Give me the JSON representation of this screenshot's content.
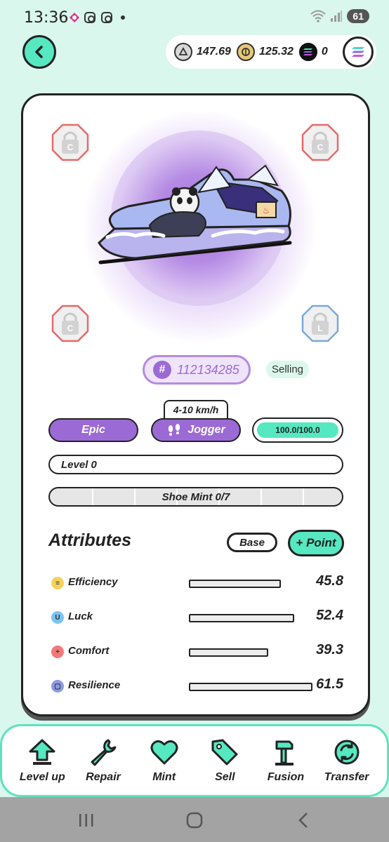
{
  "status_bar": {
    "time": "13:36",
    "battery": "61"
  },
  "wallet": {
    "gst": "147.69",
    "gmt": "125.32",
    "sol": "0"
  },
  "sneaker": {
    "id_symbol": "#",
    "id": "112134285",
    "status": "Selling",
    "speed_range": "4-10 km/h",
    "rarity": "Epic",
    "type": "Jogger",
    "durability": "100.0/100.0",
    "level": "Level 0",
    "shoe_mint": "Shoe Mint 0/7",
    "shoe_mint_fraction": 0.0,
    "gem_slots": [
      {
        "letter": "C",
        "state": "locked",
        "color": "#e46a6a"
      },
      {
        "letter": "C",
        "state": "locked",
        "color": "#e46a6a"
      },
      {
        "letter": "C",
        "state": "locked",
        "color": "#e46a6a"
      },
      {
        "letter": "L",
        "state": "locked",
        "color": "#7aa9d8"
      }
    ]
  },
  "attributes": {
    "title": "Attributes",
    "base_button": "Base",
    "point_button": "+ Point",
    "items": [
      {
        "label": "Efficiency",
        "value": "45.8",
        "fraction": 0.745,
        "icon_color": "#f5d35a"
      },
      {
        "label": "Luck",
        "value": "52.4",
        "fraction": 0.85,
        "icon_color": "#7bc4f0"
      },
      {
        "label": "Comfort",
        "value": "39.3",
        "fraction": 0.64,
        "icon_color": "#f07a7a"
      },
      {
        "label": "Resilience",
        "value": "61.5",
        "fraction": 1.0,
        "icon_color": "#8a9be0"
      }
    ]
  },
  "actions": [
    {
      "label": "Level up",
      "icon": "level-up-icon"
    },
    {
      "label": "Repair",
      "icon": "wrench-icon"
    },
    {
      "label": "Mint",
      "icon": "heart-icon"
    },
    {
      "label": "Sell",
      "icon": "tag-icon"
    },
    {
      "label": "Fusion",
      "icon": "hammer-icon"
    },
    {
      "label": "Transfer",
      "icon": "transfer-icon"
    }
  ],
  "colors": {
    "accent": "#56e8c0",
    "epic_purple": "#9b6ad4",
    "background": "#d9f7ec"
  }
}
